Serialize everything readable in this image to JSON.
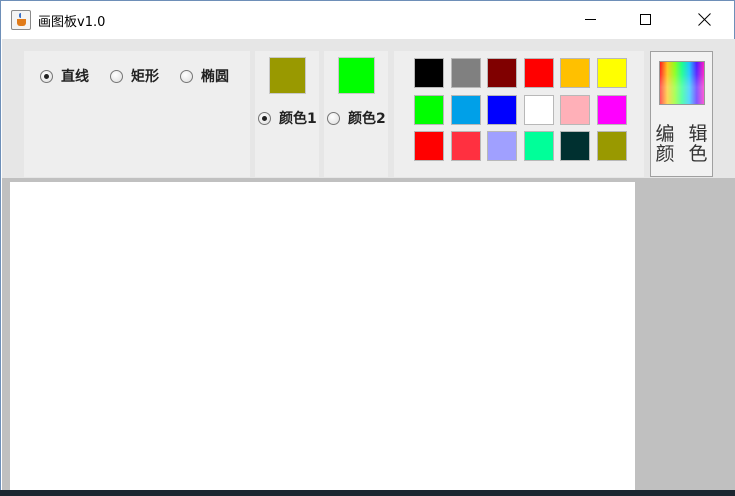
{
  "window": {
    "title": "画图板v1.0",
    "icon": "java-cup-icon",
    "controls": {
      "minimize": "minimize-icon",
      "maximize": "maximize-icon",
      "close": "close-icon"
    }
  },
  "shapes": {
    "options": [
      {
        "label": "直线",
        "selected": true
      },
      {
        "label": "矩形",
        "selected": false
      },
      {
        "label": "椭圆",
        "selected": false
      }
    ]
  },
  "colors": {
    "color1": {
      "label": "颜色1",
      "value": "#999900",
      "selected": true
    },
    "color2": {
      "label": "颜色2",
      "value": "#00ff00",
      "selected": false
    }
  },
  "palette": [
    "#000000",
    "#808080",
    "#800000",
    "#ff0000",
    "#ffc000",
    "#ffff00",
    "#00ff00",
    "#00a0e8",
    "#0000ff",
    "#ffffff",
    "#ffb0b8",
    "#ff00ff",
    "#ff0000",
    "#ff3040",
    "#a0a0ff",
    "#00ff99",
    "#003030",
    "#999900"
  ],
  "edit_colors": {
    "label": "编辑颜色",
    "line1": "编 辑",
    "line2": "颜 色"
  },
  "theme": {
    "toolbar_bg": "#e6e6e6",
    "panel_bg": "#eeeeee",
    "canvas_bg": "#ffffff",
    "workspace_bg": "#c0c0c0"
  }
}
